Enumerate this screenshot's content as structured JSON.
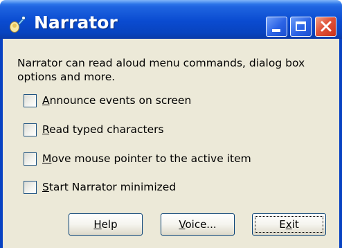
{
  "window": {
    "title": "Narrator",
    "icon": "narrator-icon",
    "controls": [
      "minimize-icon",
      "maximize-icon",
      "close-icon"
    ]
  },
  "description": "Narrator can read aloud menu commands, dialog box options and more.",
  "options": [
    {
      "accel": "A",
      "rest": "nnounce events on screen",
      "checked": false
    },
    {
      "accel": "R",
      "rest": "ead typed characters",
      "checked": false
    },
    {
      "accel": "M",
      "rest": "ove mouse pointer to the active item",
      "checked": false
    },
    {
      "accel": "S",
      "rest": "tart Narrator minimized",
      "checked": false
    }
  ],
  "buttons": {
    "help": {
      "accel": "H",
      "rest": "elp"
    },
    "voice": {
      "accel": "V",
      "rest": "oice..."
    },
    "exit": {
      "pre": "E",
      "accel": "x",
      "rest": "it"
    }
  },
  "colors": {
    "titlebar": "#0a4bd0",
    "client_bg": "#ece9d8",
    "close_button": "#e0533a"
  }
}
